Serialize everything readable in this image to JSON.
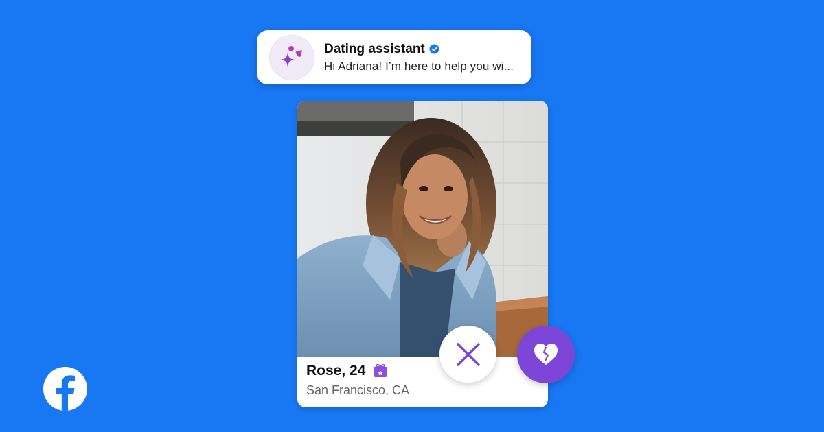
{
  "assistant": {
    "title": "Dating assistant",
    "message": "Hi Adriana! I’m here to help you wi...",
    "icon": "sparkle-icon",
    "verified_icon": "verified-badge-icon"
  },
  "profile": {
    "name_age": "Rose, 24",
    "location": "San Francisco, CA",
    "badge_icon": "gift-icon"
  },
  "actions": {
    "pass_icon": "close-icon",
    "like_icon": "heart-icon"
  },
  "brand": {
    "logo": "facebook-logo",
    "background": "#1877F2",
    "accent": "#7E46D8",
    "verified": "#1877F2"
  }
}
